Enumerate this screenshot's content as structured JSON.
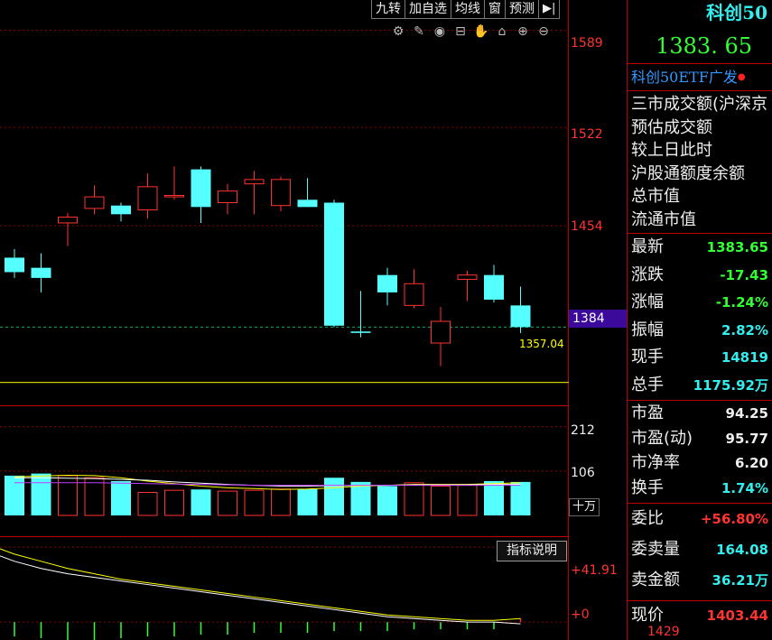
{
  "toolbar": {
    "buttons": [
      "九转",
      "加自选",
      "均线",
      "窗",
      "预测"
    ],
    "collapse_icon": "collapse-right-icon"
  },
  "chart_tools": [
    "settings-icon",
    "draw-pen-icon",
    "eye-icon",
    "lock-box-icon",
    "pan-hand-icon",
    "lock-icon",
    "zoom-in-icon",
    "zoom-out-icon"
  ],
  "right_panel": {
    "title": "科创50",
    "price": "1383. 65",
    "etf_link": "科创50ETF广发",
    "turnover_labels": [
      "三市成交额(沪深京",
      "预估成交额",
      "较上日此时",
      "沪股通额度余额",
      "总市值",
      "流通市值"
    ],
    "quote_rows": [
      {
        "label": "最新",
        "value": "1383.65",
        "color": "g"
      },
      {
        "label": "涨跌",
        "value": "-17.43",
        "color": "g"
      },
      {
        "label": "涨幅",
        "value": "-1.24%",
        "color": "g"
      },
      {
        "label": "振幅",
        "value": "2.82%",
        "color": "c"
      },
      {
        "label": "现手",
        "value": "14819",
        "color": "c"
      },
      {
        "label": "总手",
        "value": "1175.92万",
        "color": "c"
      }
    ],
    "valuation_rows": [
      {
        "label": "市盈",
        "value": "94.25",
        "color": "w"
      },
      {
        "label": "市盈(动)",
        "value": "95.77",
        "color": "w"
      },
      {
        "label": "市净率",
        "value": "6.20",
        "color": "w"
      },
      {
        "label": "换手",
        "value": "1.74%",
        "color": "c"
      }
    ],
    "order_rows": [
      {
        "label": "委比",
        "value": "+56.80%",
        "color": "r"
      },
      {
        "label": "委卖量",
        "value": "164.08",
        "color": "c"
      },
      {
        "label": "卖金额",
        "value": "36.21万",
        "color": "c"
      }
    ],
    "price_row": {
      "label": "现价",
      "value": "1403.44",
      "color": "r"
    },
    "bottom_price": "1429"
  },
  "main_chart": {
    "y_labels": [
      "1589",
      "1522",
      "1454"
    ],
    "last_price_label": "1384",
    "low_label": "1357.04"
  },
  "volume_chart": {
    "y_labels": [
      "212",
      "106"
    ],
    "unit": "十万"
  },
  "indicator_chart": {
    "button": "指标说明",
    "y_labels": [
      "+41.91",
      "+0"
    ]
  },
  "chart_data": [
    {
      "type": "candlestick",
      "ylim": [
        1330,
        1610
      ],
      "gridlines": [
        1589,
        1522,
        1454,
        1384
      ],
      "last_price": 1384,
      "low_marker": 1357.04,
      "candles": [
        {
          "o": 1432,
          "h": 1438,
          "l": 1418,
          "c": 1422
        },
        {
          "o": 1425,
          "h": 1435,
          "l": 1408,
          "c": 1418
        },
        {
          "o": 1456,
          "h": 1463,
          "l": 1440,
          "c": 1460
        },
        {
          "o": 1466,
          "h": 1482,
          "l": 1462,
          "c": 1474
        },
        {
          "o": 1468,
          "h": 1470,
          "l": 1457,
          "c": 1462
        },
        {
          "o": 1465,
          "h": 1490,
          "l": 1459,
          "c": 1481
        },
        {
          "o": 1474,
          "h": 1495,
          "l": 1472,
          "c": 1475
        },
        {
          "o": 1493,
          "h": 1495,
          "l": 1456,
          "c": 1467
        },
        {
          "o": 1470,
          "h": 1483,
          "l": 1462,
          "c": 1478
        },
        {
          "o": 1483,
          "h": 1492,
          "l": 1462,
          "c": 1486
        },
        {
          "o": 1468,
          "h": 1488,
          "l": 1464,
          "c": 1486
        },
        {
          "o": 1472,
          "h": 1487,
          "l": 1467,
          "c": 1467
        },
        {
          "o": 1470,
          "h": 1472,
          "l": 1384,
          "c": 1385
        },
        {
          "o": 1381,
          "h": 1409,
          "l": 1377,
          "c": 1380
        },
        {
          "o": 1420,
          "h": 1425,
          "l": 1399,
          "c": 1408
        },
        {
          "o": 1399,
          "h": 1424,
          "l": 1397,
          "c": 1414
        },
        {
          "o": 1373,
          "h": 1398,
          "l": 1357,
          "c": 1388
        },
        {
          "o": 1417,
          "h": 1423,
          "l": 1402,
          "c": 1420
        },
        {
          "o": 1420,
          "h": 1427,
          "l": 1401,
          "c": 1403
        },
        {
          "o": 1399,
          "h": 1412,
          "l": 1380,
          "c": 1384
        }
      ]
    },
    {
      "type": "bar",
      "ylim": [
        0,
        250
      ],
      "gridlines": [
        212,
        106
      ],
      "values": [
        95,
        100,
        95,
        90,
        82,
        55,
        60,
        62,
        58,
        60,
        63,
        63,
        90,
        80,
        70,
        78,
        70,
        72,
        82,
        80
      ]
    },
    {
      "type": "line",
      "ylim": [
        -10,
        45
      ],
      "gridlines": [
        41.91,
        0
      ],
      "series": [
        {
          "color": "#ffffff",
          "values": [
            34,
            30,
            27,
            25,
            23,
            21,
            19,
            17,
            15,
            13,
            11,
            9,
            7,
            5,
            3,
            2,
            1,
            0,
            0,
            -1
          ]
        },
        {
          "color": "#ffff00",
          "values": [
            38,
            34,
            30,
            27,
            24,
            22,
            20,
            18,
            16,
            14,
            12,
            10,
            8,
            6,
            4,
            3,
            2,
            1,
            1,
            2
          ]
        }
      ],
      "bars": [
        -8,
        -9,
        -10,
        -10,
        -9,
        -8,
        -8,
        -7,
        -7,
        -6,
        -6,
        -6,
        -5,
        -5,
        -5,
        -4,
        -4,
        -4,
        -4,
        2
      ]
    }
  ]
}
